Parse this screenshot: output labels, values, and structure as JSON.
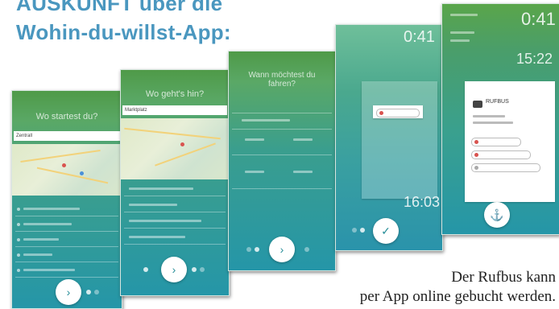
{
  "headline": {
    "line1": "AUSKUNFT über die",
    "line2": "Wohin-du-willst-App:"
  },
  "caption": {
    "line1": "Der Rufbus kann",
    "line2": "per App online gebucht werden."
  },
  "screen1": {
    "title": "Wo startest du?",
    "search_value": "Zentrall",
    "next_icon": "chevron-right-icon"
  },
  "screen2": {
    "title": "Wo geht's hin?",
    "search_value": "Marktplatz",
    "next_icon": "chevron-right-icon"
  },
  "screen3": {
    "title_line1": "Wann möchtest du",
    "title_line2": "fahren?",
    "next_icon": "chevron-right-icon"
  },
  "screen4": {
    "time_top": "0:41",
    "time_bottom": "16:03",
    "confirm_icon": "checkmark-icon"
  },
  "screen5": {
    "time_top": "0:41",
    "time_bottom": "15:22",
    "bus_label": "RUFBUS",
    "anchor_icon": "anchor-icon"
  },
  "colors": {
    "headline": "#4a97bf",
    "green_top": "#4f9a48",
    "teal_bottom": "#2596a8"
  }
}
